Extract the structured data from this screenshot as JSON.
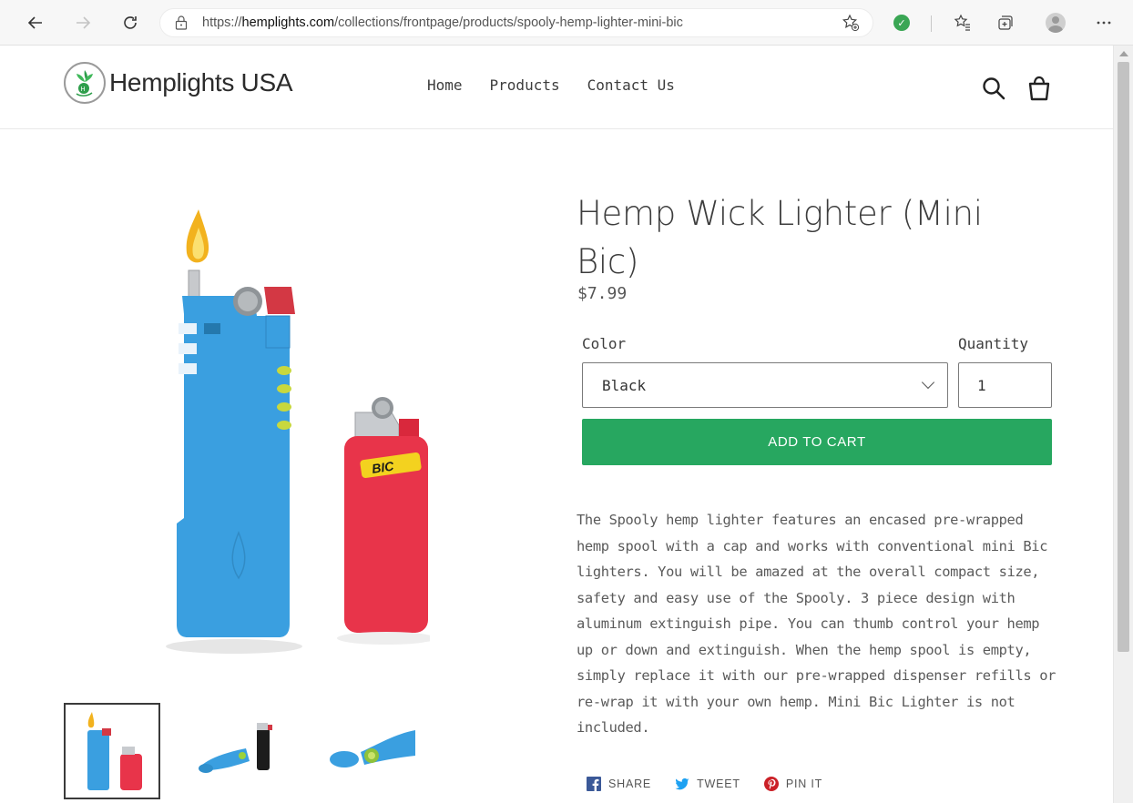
{
  "browser": {
    "url_prefix": "https://",
    "url_host": "hemplights.com",
    "url_path": "/collections/frontpage/products/spooly-hemp-lighter-mini-bic",
    "icons": [
      "back-icon",
      "forward-icon",
      "refresh-icon",
      "lock-icon",
      "add-favorite-icon",
      "shield-extension-icon",
      "favorites-icon",
      "collections-icon",
      "profile-icon",
      "more-icon"
    ]
  },
  "site": {
    "brand": "Hemplights USA",
    "nav": [
      "Home",
      "Products",
      "Contact Us"
    ],
    "header_icons": [
      "search-icon",
      "cart-icon"
    ]
  },
  "product": {
    "title": "Hemp Wick Lighter (Mini Bic)",
    "price": "$7.99",
    "color_label": "Color",
    "color_value": "Black",
    "quantity_label": "Quantity",
    "quantity_value": "1",
    "add_to_cart": "ADD TO CART",
    "description": "The Spooly hemp lighter features an encased pre-wrapped hemp spool with a cap and works with conventional mini Bic lighters. You will be amazed at the overall compact size, safety and easy use of the Spooly. 3 piece design with aluminum extinguish pipe. You can thumb control your hemp up or down and extinguish. When the hemp spool is empty, simply replace it with our pre-wrapped dispenser refills or re-wrap it with your own hemp. Mini Bic Lighter is not included.",
    "share": [
      "SHARE",
      "TWEET",
      "PIN IT"
    ],
    "lighter_brand": "BIC"
  },
  "colors": {
    "accent": "#27a760",
    "spooly_blue": "#3a9fe0",
    "bic_red": "#e8344a"
  }
}
